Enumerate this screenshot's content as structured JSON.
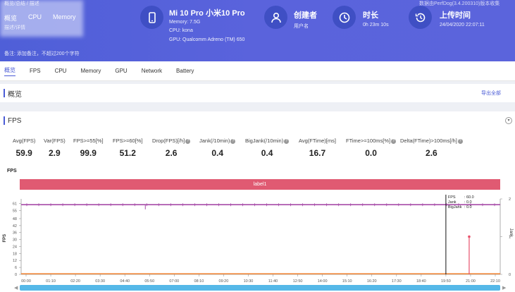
{
  "header": {
    "tabs": [
      "概览",
      "CPU",
      "Memory"
    ],
    "top_small_1": "概览/总结 / 描述",
    "top_small_2": "描述/详情",
    "device": {
      "name": "Mi 10 Pro 小米10 Pro",
      "memory": "Memory: 7.5G",
      "cpu": "CPU: kona",
      "gpu": "GPU: Qualcomm Adreno (TM) 650"
    },
    "creator": {
      "title": "创建者",
      "value": "用户名"
    },
    "duration": {
      "title": "时长",
      "value": "0h 23m 10s"
    },
    "upload": {
      "title": "上传时间",
      "value": "24/04/2020 22:07:11"
    },
    "source": "数据由PerfDog(3.4.200310)版本收集",
    "note": "备注: 添加备注，不超过200个字符"
  },
  "nav": [
    "概览",
    "FPS",
    "CPU",
    "Memory",
    "GPU",
    "Network",
    "Battery"
  ],
  "overview": {
    "title": "概览",
    "export": "导出全部"
  },
  "fps_section": {
    "title": "FPS",
    "stats": [
      {
        "label": "Avg(FPS)",
        "value": "59.9",
        "help": false
      },
      {
        "label": "Var(FPS)",
        "value": "2.9",
        "help": false
      },
      {
        "label": "FPS>=55[%]",
        "value": "99.9",
        "help": false
      },
      {
        "label": "FPS>=60[%]",
        "value": "51.2",
        "help": false
      },
      {
        "label": "Drop(FPS)[/h]",
        "value": "2.6",
        "help": true
      },
      {
        "label": "Jank(/10min)",
        "value": "0.4",
        "help": true
      },
      {
        "label": "BigJank(/10min)",
        "value": "0.4",
        "help": true
      },
      {
        "label": "Avg(FTime)[ms]",
        "value": "16.7",
        "help": false
      },
      {
        "label": "FTime>=100ms[%]",
        "value": "0.0",
        "help": true
      },
      {
        "label": "Delta(FTime)>100ms[/h]",
        "value": "2.6",
        "help": true
      }
    ]
  },
  "chart_label": "FPS",
  "band_label": "label1",
  "colors": {
    "header": "#5562da",
    "accent": "#4a5bd6",
    "fps_line": "#a64ca8",
    "jank": "#e8506a",
    "bigjank": "#f0883a",
    "band": "#e05a72",
    "scrollbar": "#55b8e8"
  },
  "chart_data": {
    "type": "line",
    "ylabel_left": "FPS",
    "ylabel_right": "Jank",
    "y_ticks_left": [
      0,
      6,
      12,
      18,
      24,
      30,
      36,
      42,
      48,
      55,
      61
    ],
    "y_ticks_right": [
      0,
      1,
      2
    ],
    "x_ticks": [
      "00:00",
      "01:10",
      "02:20",
      "03:30",
      "04:40",
      "05:50",
      "07:00",
      "08:10",
      "09:20",
      "10:30",
      "11:40",
      "12:50",
      "14:00",
      "15:10",
      "16:20",
      "17:30",
      "18:40",
      "19:50",
      "21:00",
      "22:10"
    ],
    "ylim_left": [
      0,
      65
    ],
    "ylim_right": [
      0,
      2
    ],
    "series": [
      {
        "name": "FPS",
        "value": 60,
        "dips": [
          {
            "x": "05:50",
            "value": 56
          }
        ]
      },
      {
        "name": "Jank",
        "spike_at": "21:00",
        "value": 1
      },
      {
        "name": "BigJank",
        "value": 0
      }
    ],
    "cursor": {
      "x": "19:50",
      "FPS": "60.0",
      "Jank": "0.0",
      "BigJank": "0.0"
    }
  }
}
